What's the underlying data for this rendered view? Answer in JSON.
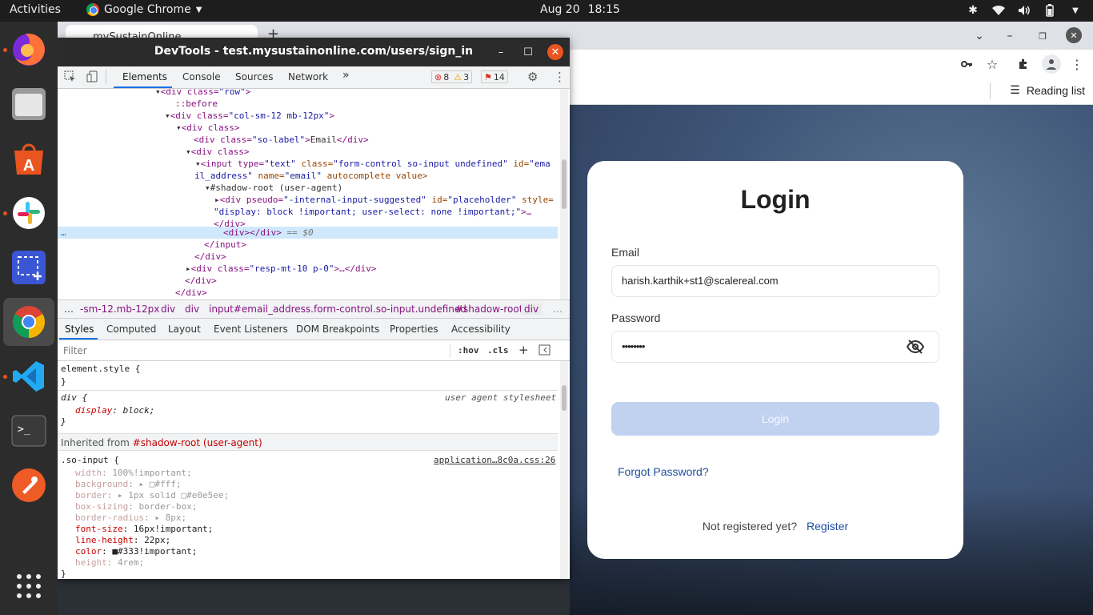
{
  "system": {
    "activities": "Activities",
    "app_name": "Google Chrome",
    "date": "Aug 20",
    "time": "18:15"
  },
  "dock": {
    "items": [
      "firefox-icon",
      "files-icon",
      "software-icon",
      "slack-icon",
      "screenshot-icon",
      "chrome-icon",
      "vscode-icon",
      "terminal-icon",
      "postman-icon",
      "apps-grid-icon"
    ]
  },
  "browser": {
    "tab_title": "mySustainOnline",
    "new_tab": "+",
    "reading_list": "Reading list"
  },
  "devtools": {
    "title": "DevTools - test.mysustainonline.com/users/sign_in",
    "tabs": [
      "Elements",
      "Console",
      "Sources",
      "Network",
      "»"
    ],
    "errors": "8",
    "warnings": "3",
    "issues": "14",
    "dom": {
      "l1_tag": "<div class=",
      "l1_val": "\"row\"",
      "l1_end": ">",
      "l2": "::before",
      "l3_tag": "<div class=",
      "l3_val": "\"col-sm-12 mb-12px\"",
      "l3_end": ">",
      "l4": "<div class>",
      "l5_a": "<div class=",
      "l5_val": "\"so-label\"",
      "l5_b": ">",
      "l5_text": "Email",
      "l5_c": "</div>",
      "l6": "<div class>",
      "l7_a": "<input type=",
      "l7_v1": "\"text\"",
      "l7_b": " class=",
      "l7_v2": "\"form-control so-input undefined\"",
      "l7_c": " id=",
      "l7_v3": "\"ema",
      "l8_v": "il_address\"",
      "l8_a": " name=",
      "l8_v2": "\"email\"",
      "l8_b": " autocomplete value>",
      "l9": "#shadow-root (user-agent)",
      "l10_a": "<div pseudo=",
      "l10_v1": "\"-internal-input-suggested\"",
      "l10_b": " id=",
      "l10_v2": "\"placeholder\"",
      "l10_c": " style=",
      "l11_v": "\"display: block !important; user-select: none !important;\"",
      "l11_end": ">…",
      "l12": "</div>",
      "l13_tag": "<div></div>",
      "l13_eq": " == $0",
      "l14": "</input>",
      "l15": "</div>",
      "l16_a": "<div class=",
      "l16_v": "\"resp-mt-10 p-0\"",
      "l16_b": ">…</div>",
      "l17": "</div>",
      "l18": "</div>",
      "ellipsis": "…"
    },
    "breadcrumb": [
      "…",
      "-sm-12.mb-12px",
      "div",
      "div",
      "input#email_address.form-control.so-input.undefined",
      "#shadow-root",
      "div",
      "…"
    ],
    "subtabs": [
      "Styles",
      "Computed",
      "Layout",
      "Event Listeners",
      "DOM Breakpoints",
      "Properties",
      "Accessibility"
    ],
    "filter_placeholder": "Filter",
    "hov": ":hov",
    "cls": ".cls",
    "plus": "+",
    "styles": {
      "element_style": "element.style {",
      "close": "}",
      "div_rule": "div {",
      "ua_label": "user agent stylesheet",
      "display_prop": "display",
      "display_val": "block;",
      "inherited_label": "Inherited from ",
      "inherited_from": "#shadow-root (user-agent)",
      "so_input_rule": ".so-input {",
      "source_link": "application…8c0a.css:26",
      "props": [
        {
          "name": "width",
          "value": "100%!important;",
          "dim": true
        },
        {
          "name": "background",
          "value": "▸ □#fff;",
          "dim": true
        },
        {
          "name": "border",
          "value": "▸ 1px solid □#e0e5ee;",
          "dim": true
        },
        {
          "name": "box-sizing",
          "value": "border-box;",
          "dim": true
        },
        {
          "name": "border-radius",
          "value": "▸ 8px;",
          "dim": true
        },
        {
          "name": "font-size",
          "value": "16px!important;",
          "dim": false
        },
        {
          "name": "line-height",
          "value": "22px;",
          "dim": false
        },
        {
          "name": "color",
          "value": "■#333!important;",
          "dim": false
        },
        {
          "name": "height",
          "value": "4rem;",
          "dim": true
        }
      ]
    }
  },
  "login": {
    "title": "Login",
    "email_label": "Email",
    "email_value": "harish.karthik+st1@scalereal.com",
    "password_label": "Password",
    "password_value": "••••••••",
    "login_button": "Login",
    "forgot_password": "Forgot Password?",
    "not_registered": "Not registered yet?",
    "register": "Register"
  }
}
